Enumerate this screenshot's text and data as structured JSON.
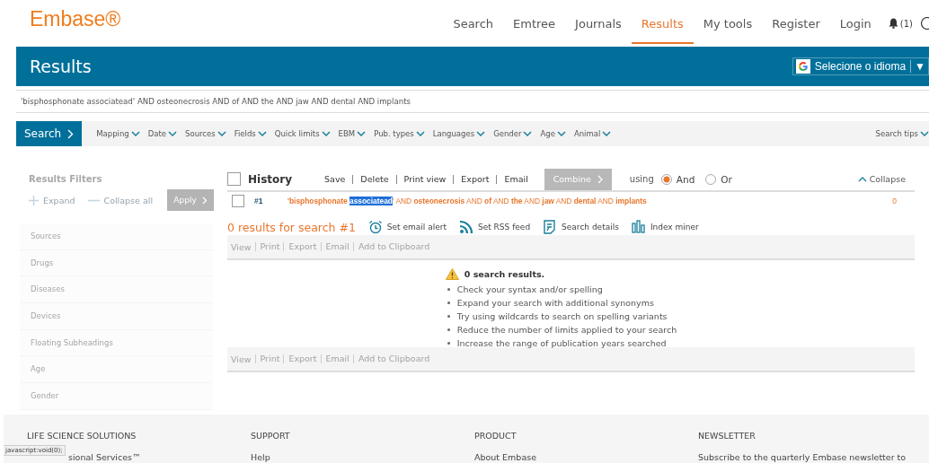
{
  "header": {
    "logo": "Embase®",
    "nav": [
      {
        "label": "Search",
        "selected": false
      },
      {
        "label": "Emtree",
        "selected": false
      },
      {
        "label": "Journals",
        "selected": false
      },
      {
        "label": "Results",
        "selected": true
      },
      {
        "label": "My tools",
        "selected": false
      },
      {
        "label": "Register",
        "selected": false
      },
      {
        "label": "Login",
        "selected": false
      }
    ],
    "notifications": "(1)"
  },
  "title_bar": {
    "title": "Results",
    "translate": {
      "label": "Selecione o idioma",
      "arrow": "▼"
    }
  },
  "search": {
    "value": "'bisphosphonate associatead' AND osteonecrosis AND of AND the AND jaw AND dental AND implants",
    "button": "Search",
    "filters": [
      "Mapping",
      "Date",
      "Sources",
      "Fields",
      "Quick limits",
      "EBM",
      "Pub. types",
      "Languages",
      "Gender",
      "Age",
      "Animal"
    ],
    "tips": "Search tips"
  },
  "results_filters": {
    "title": "Results Filters",
    "expand": "Expand",
    "collapse_all": "Collapse all",
    "apply": "Apply",
    "items": [
      "Sources",
      "Drugs",
      "Diseases",
      "Devices",
      "Floating Subheadings",
      "Age",
      "Gender"
    ]
  },
  "history": {
    "title": "History",
    "checked": false,
    "actions": [
      "Save",
      "Delete",
      "Print view",
      "Export",
      "Email"
    ],
    "combine": "Combine",
    "using": "using",
    "operators": [
      {
        "label": "And",
        "selected": true
      },
      {
        "label": "Or",
        "selected": false
      }
    ],
    "collapse": "Collapse",
    "rows": [
      {
        "number": "#1",
        "checked": false,
        "count": "0",
        "query": [
          {
            "text": "'bisphosphonate ",
            "bold": true,
            "highlighted": false
          },
          {
            "text": "associatead",
            "bold": true,
            "highlighted": true
          },
          {
            "text": "' AND ",
            "bold": false,
            "highlighted": false
          },
          {
            "text": "osteonecrosis",
            "bold": true,
            "highlighted": false
          },
          {
            "text": " AND ",
            "bold": false,
            "highlighted": false
          },
          {
            "text": "of",
            "bold": true,
            "highlighted": false
          },
          {
            "text": " AND ",
            "bold": false,
            "highlighted": false
          },
          {
            "text": "the",
            "bold": true,
            "highlighted": false
          },
          {
            "text": " AND ",
            "bold": false,
            "highlighted": false
          },
          {
            "text": "jaw",
            "bold": true,
            "highlighted": false
          },
          {
            "text": " AND ",
            "bold": false,
            "highlighted": false
          },
          {
            "text": "dental",
            "bold": true,
            "highlighted": false
          },
          {
            "text": " AND ",
            "bold": false,
            "highlighted": false
          },
          {
            "text": "implants",
            "bold": true,
            "highlighted": false
          }
        ]
      }
    ]
  },
  "results": {
    "heading": "0 results for search #1",
    "tools": [
      {
        "kind": "alarm",
        "label": "Set email alert"
      },
      {
        "kind": "rss",
        "label": "Set RSS feed"
      },
      {
        "kind": "details",
        "label": "Search details"
      },
      {
        "kind": "bars",
        "label": "Index miner"
      }
    ],
    "actions_top": [
      "View",
      "Print",
      "Export",
      "Email",
      "Add to Clipboard"
    ],
    "empty_title": "0 search results.",
    "tips": [
      "Check your syntax and/or spelling",
      "Expand your search with additional synonyms",
      "Try using wildcards to search on spelling variants",
      "Reduce the number of limits applied to your search",
      "Increase the range of publication years searched"
    ],
    "actions_bottom": [
      "View",
      "Print",
      "Export",
      "Email",
      "Add to Clipboard"
    ]
  },
  "footer": {
    "columns": [
      {
        "heading": "LIFE SCIENCE SOLUTIONS",
        "link": "sional Services™"
      },
      {
        "heading": "SUPPORT",
        "link": "Help"
      },
      {
        "heading": "PRODUCT",
        "link": "About Embase"
      },
      {
        "heading": "NEWSLETTER",
        "link": "Subscribe to the quarterly Embase newsletter to"
      }
    ]
  },
  "status_bar": "javascript:void(0);"
}
